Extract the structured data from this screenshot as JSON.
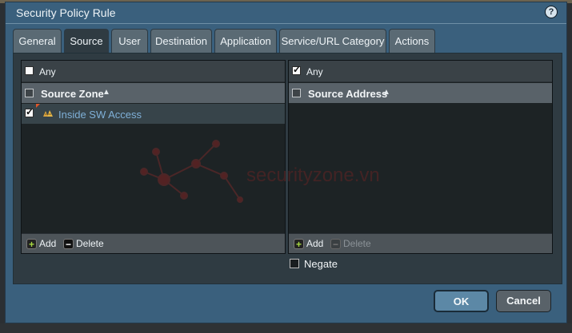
{
  "window": {
    "title": "Security Policy Rule"
  },
  "tabs": [
    {
      "label": "General"
    },
    {
      "label": "Source"
    },
    {
      "label": "User"
    },
    {
      "label": "Destination"
    },
    {
      "label": "Application"
    },
    {
      "label": "Service/URL Category"
    },
    {
      "label": "Actions"
    }
  ],
  "active_tab": "Source",
  "source_zone_panel": {
    "any_label": "Any",
    "any_checked": false,
    "column_header": "Source Zone",
    "rows": [
      {
        "label": "Inside SW Access",
        "checked": true
      }
    ],
    "add_label": "Add",
    "delete_label": "Delete"
  },
  "source_address_panel": {
    "any_label": "Any",
    "any_checked": true,
    "column_header": "Source Address",
    "add_label": "Add",
    "delete_label": "Delete",
    "delete_disabled": true
  },
  "negate": {
    "label": "Negate",
    "checked": false
  },
  "buttons": {
    "ok": "OK",
    "cancel": "Cancel"
  },
  "watermark": {
    "text": "securityzone.vn"
  },
  "colors": {
    "dialog_bg": "#3a607d",
    "panel_bg": "#2f3b42",
    "link": "#7fb0d8",
    "add_icon": "#a7d840"
  }
}
